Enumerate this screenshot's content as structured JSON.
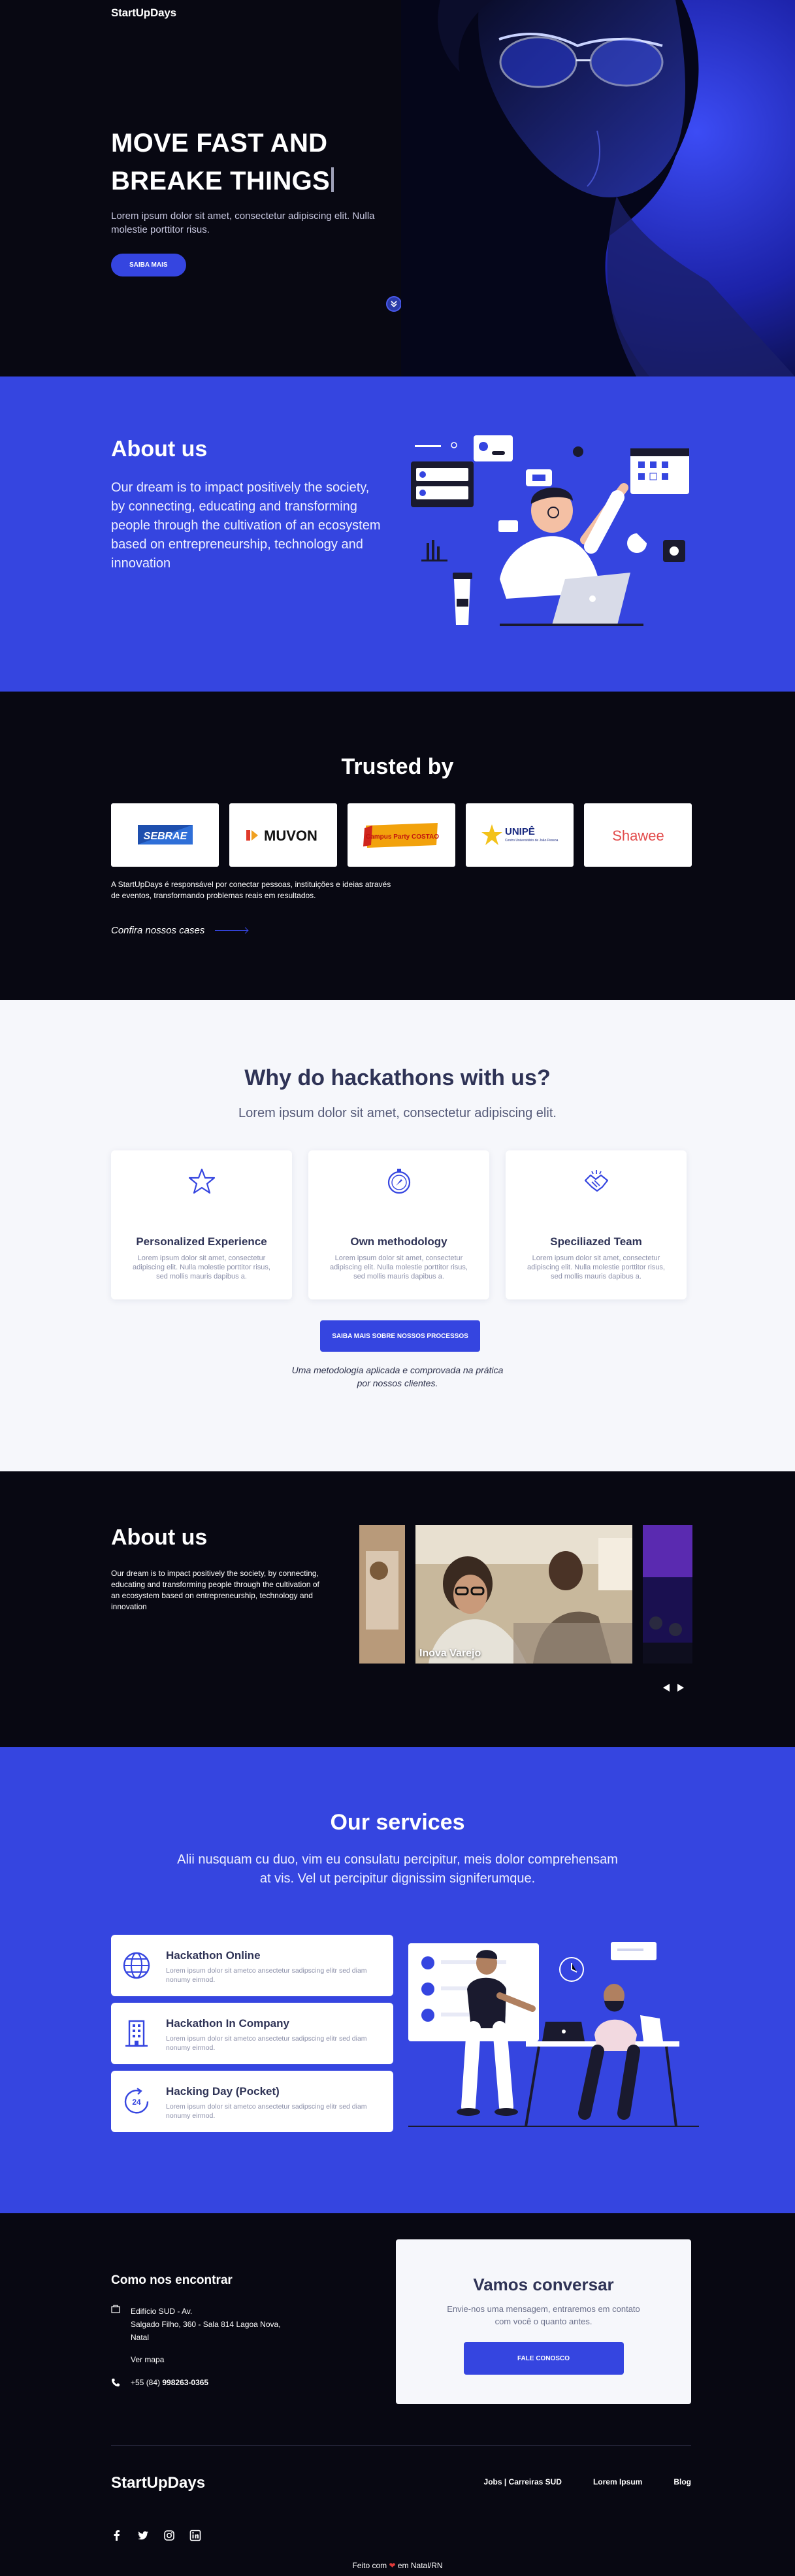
{
  "brand": "StartUpDays",
  "hero": {
    "title_line1": "MOVE FAST AND",
    "title_line2": "BREAKE THINGS",
    "subtitle": "Lorem ipsum dolor sit amet, consectetur adipiscing elit. Nulla molestie porttitor risus.",
    "cta": "SAIBA MAIS"
  },
  "about1": {
    "title": "About us",
    "text": "Our dream is to impact positively the society, by connecting, educating and transforming people through the cultivation of an ecosystem based on entrepreneurship, technology and innovation"
  },
  "trusted": {
    "title": "Trusted by",
    "logos": [
      "SEBRAE",
      "MUVON",
      "Campus Party COSTAO",
      "UNIPÊ",
      "Shawee"
    ],
    "unipe_sub": "Centro Universitário de João Pessoa",
    "description": "A StartUpDays é responsável por conectar pessoas, instituições e ideias através de eventos, transformando problemas reais em resultados.",
    "cases_link": "Confira nossos cases"
  },
  "why": {
    "title": "Why do hackathons with us?",
    "lead": "Lorem ipsum dolor sit amet, consectetur adipiscing elit.",
    "cards": [
      {
        "icon": "star-icon",
        "title": "Personalized Experience",
        "text": "Lorem ipsum dolor sit amet, consectetur adipiscing elit. Nulla molestie porttitor risus, sed mollis mauris dapibus a."
      },
      {
        "icon": "compass-icon",
        "title": "Own methodology",
        "text": "Lorem ipsum dolor sit amet, consectetur adipiscing elit. Nulla molestie porttitor risus, sed mollis mauris dapibus a."
      },
      {
        "icon": "handshake-icon",
        "title": "Speciliazed Team",
        "text": "Lorem ipsum dolor sit amet, consectetur adipiscing elit. Nulla molestie porttitor risus, sed mollis mauris dapibus a."
      }
    ],
    "cta": "SAIBA MAIS SOBRE NOSSOS PROCESSOS",
    "note_line1": "Uma metodologia aplicada e comprovada na prática",
    "note_line2": "por nossos clientes."
  },
  "about2": {
    "title": "About us",
    "text": "Our dream is to impact positively the society, by connecting, educating and transforming people through the cultivation of an ecosystem based on entrepreneurship, technology and innovation",
    "slide_caption": "Inova Varejo"
  },
  "services": {
    "title": "Our services",
    "lead": "Alii nusquam cu duo, vim eu consulatu percipitur, meis dolor comprehensam at vis. Vel ut percipitur dignissim signiferumque.",
    "items": [
      {
        "icon": "globe-icon",
        "title": "Hackathon Online",
        "text": "Lorem ipsum dolor sit ametco ansectetur sadipscing elitr sed diam nonumy eirmod."
      },
      {
        "icon": "building-icon",
        "title": "Hackathon In Company",
        "text": "Lorem ipsum dolor sit ametco ansectetur sadipscing elitr sed diam nonumy eirmod."
      },
      {
        "icon": "24h-icon",
        "title": "Hacking Day (Pocket)",
        "text": "Lorem ipsum dolor sit ametco ansectetur sadipscing elitr sed diam nonumy eirmod."
      }
    ]
  },
  "contact": {
    "title": "Como nos encontrar",
    "address_line1": "Edifício SUD - Av.",
    "address_line2": "Salgado Filho, 360 - Sala 814 Lagoa Nova,",
    "address_line3": "Natal",
    "map_link": "Ver mapa",
    "phone_prefix": "+55 (84)",
    "phone_number": "998263-0365",
    "talk_title": "Vamos conversar",
    "talk_text": "Envie-nos uma mensagem, entraremos em contato com você o quanto antes.",
    "talk_cta": "FALE CONOSCO"
  },
  "footer": {
    "links": [
      "Jobs | Carreiras SUD",
      "Lorem Ipsum",
      "Blog"
    ],
    "made_prefix": "Feito com",
    "made_suffix": "em Natal/RN",
    "social": [
      "facebook-icon",
      "twitter-icon",
      "instagram-icon",
      "linkedin-icon"
    ]
  },
  "colors": {
    "accent": "#3545e0",
    "dark": "#080812",
    "light": "#f6f7fb"
  }
}
